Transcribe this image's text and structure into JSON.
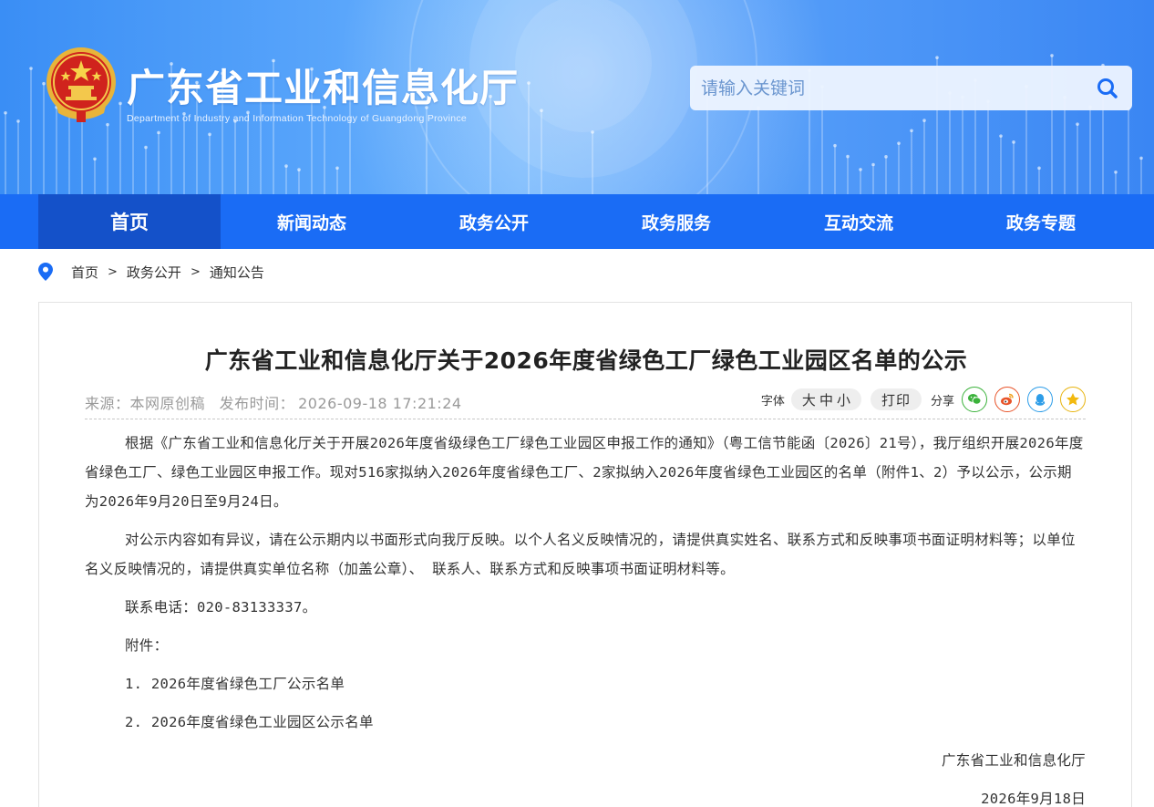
{
  "header": {
    "site_title": "广东省工业和信息化厅",
    "site_subtitle": "Department of Industry and Information Technology of Guangdong Province",
    "search_placeholder": "请输入关键词",
    "search_icon": "search-icon",
    "emblem": "national-emblem"
  },
  "nav": {
    "items": [
      {
        "label": "首页",
        "active": true
      },
      {
        "label": "新闻动态"
      },
      {
        "label": "政务公开"
      },
      {
        "label": "政务服务"
      },
      {
        "label": "互动交流"
      },
      {
        "label": "政务专题"
      }
    ]
  },
  "breadcrumb": {
    "icon": "location-pin-icon",
    "items": [
      "首页",
      "政务公开",
      "通知公告"
    ],
    "separator": ">"
  },
  "article": {
    "title": "广东省工业和信息化厅关于2026年度省绿色工厂绿色工业园区名单的公示",
    "source": "来源：本网原创稿",
    "publish_label": "发布时间：",
    "publish_time": "2026-09-18 17:21:24",
    "toolbar": {
      "font_label": "字体",
      "font_large": "大",
      "font_medium": "中",
      "font_small": "小",
      "print": "打印",
      "share_label": "分享",
      "share_icons": [
        "wechat-icon",
        "weibo-icon",
        "qq-icon",
        "qzone-icon"
      ]
    },
    "paragraphs": [
      "根据《广东省工业和信息化厅关于开展2026年度省级绿色工厂绿色工业园区申报工作的通知》（粤工信节能函〔2026〕21号），我厅组织开展2026年度省绿色工厂、绿色工业园区申报工作。现对516家拟纳入2026年度省绿色工厂、2家拟纳入2026年度省绿色工业园区的名单（附件1、2）予以公示，公示期为2026年9月20日至9月24日。",
      "对公示内容如有异议，请在公示期内以书面形式向我厅反映。以个人名义反映情况的，请提供真实姓名、联系方式和反映事项书面证明材料等；以单位名义反映情况的，请提供真实单位名称（加盖公章）、 联系人、联系方式和反映事项书面证明材料等。",
      "联系电话：020-83133337。",
      "附件：",
      "1. 2026年度省绿色工厂公示名单",
      "2. 2026年度省绿色工业园区公示名单"
    ],
    "signature": "广东省工业和信息化厅",
    "date": "2026年9月18日"
  },
  "colors": {
    "nav": "#1a6cf5",
    "nav_active": "#1451c9",
    "wechat": "#3bb23b",
    "weibo": "#e8542a",
    "qq": "#2d9de8",
    "qzone": "#e8b40f"
  }
}
